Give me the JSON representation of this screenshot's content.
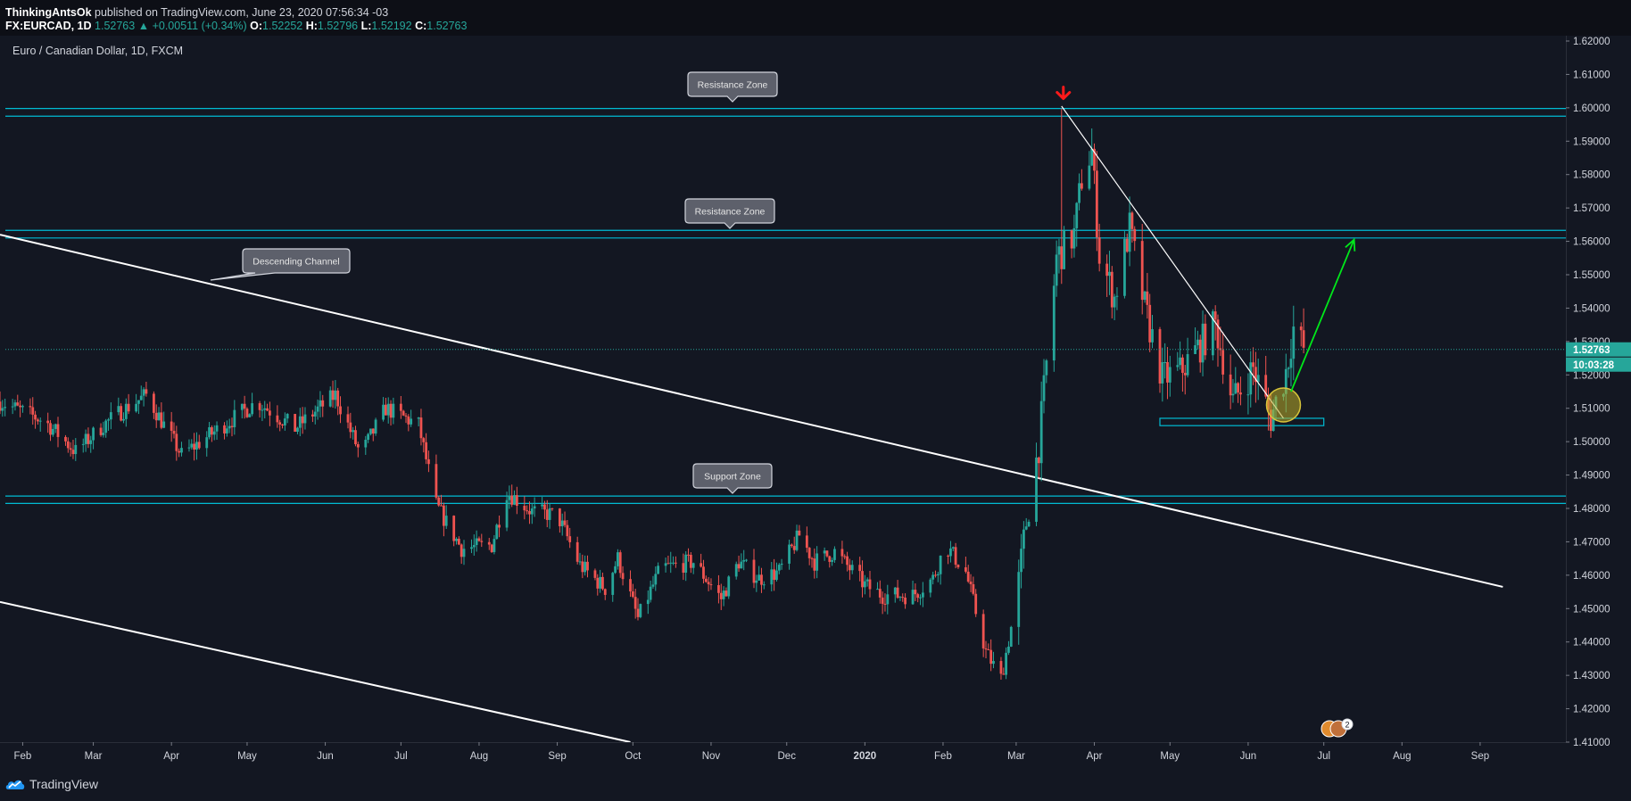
{
  "header": {
    "author": "ThinkingAntsOk",
    "published": "published on TradingView.com, June 23, 2020 07:56:34 -03",
    "symbol": "FX:EURCAD, 1D",
    "last": "1.52763",
    "change": "+0.00511 (+0.34%)",
    "o_label": "O:",
    "o": "1.52252",
    "h_label": "H:",
    "h": "1.52796",
    "l_label": "L:",
    "l": "1.52192",
    "c_label": "C:",
    "c": "1.52763"
  },
  "footer": {
    "brand": "TradingView"
  },
  "chart_data": {
    "type": "candlestick",
    "title": "Euro / Canadian Dollar, 1D, FXCM",
    "ylim": [
      1.41,
      1.62
    ],
    "y_ticks": [
      "1.41000",
      "1.42000",
      "1.43000",
      "1.44000",
      "1.45000",
      "1.46000",
      "1.47000",
      "1.48000",
      "1.49000",
      "1.50000",
      "1.51000",
      "1.52000",
      "1.53000",
      "1.54000",
      "1.55000",
      "1.56000",
      "1.57000",
      "1.58000",
      "1.59000",
      "1.60000",
      "1.61000",
      "1.62000"
    ],
    "x_ticks": [
      "Feb",
      "Mar",
      "Apr",
      "May",
      "Jun",
      "Jul",
      "Aug",
      "Sep",
      "Oct",
      "Nov",
      "Dec",
      "2020",
      "Feb",
      "Mar",
      "Apr",
      "May",
      "Jun",
      "Jul",
      "Aug",
      "Sep"
    ],
    "x_range": [
      "2019-01-23",
      "2020-10-05"
    ],
    "last_price": "1.52763",
    "countdown": "10:03:28",
    "colors": {
      "up": "#26a69a",
      "down": "#ef5350",
      "zone": "#00bcd4",
      "trend": "#ffffff",
      "target": "#00e81a",
      "peak_marker": "#ff1a1a"
    },
    "closes": [
      {
        "d": "2019-01-23",
        "v": 1.512
      },
      {
        "d": "2019-02-10",
        "v": 1.506
      },
      {
        "d": "2019-02-22",
        "v": 1.497
      },
      {
        "d": "2019-03-05",
        "v": 1.505
      },
      {
        "d": "2019-03-12",
        "v": 1.509
      },
      {
        "d": "2019-03-22",
        "v": 1.514
      },
      {
        "d": "2019-04-05",
        "v": 1.496
      },
      {
        "d": "2019-04-20",
        "v": 1.504
      },
      {
        "d": "2019-05-05",
        "v": 1.512
      },
      {
        "d": "2019-05-20",
        "v": 1.504
      },
      {
        "d": "2019-06-05",
        "v": 1.514
      },
      {
        "d": "2019-06-15",
        "v": 1.496
      },
      {
        "d": "2019-06-25",
        "v": 1.51
      },
      {
        "d": "2019-07-08",
        "v": 1.505
      },
      {
        "d": "2019-07-15",
        "v": 1.481
      },
      {
        "d": "2019-07-25",
        "v": 1.468
      },
      {
        "d": "2019-08-06",
        "v": 1.469
      },
      {
        "d": "2019-08-12",
        "v": 1.485
      },
      {
        "d": "2019-08-22",
        "v": 1.479
      },
      {
        "d": "2019-09-01",
        "v": 1.478
      },
      {
        "d": "2019-09-10",
        "v": 1.463
      },
      {
        "d": "2019-09-20",
        "v": 1.456
      },
      {
        "d": "2019-09-25",
        "v": 1.465
      },
      {
        "d": "2019-10-03",
        "v": 1.447
      },
      {
        "d": "2019-10-12",
        "v": 1.462
      },
      {
        "d": "2019-10-25",
        "v": 1.464
      },
      {
        "d": "2019-11-05",
        "v": 1.453
      },
      {
        "d": "2019-11-12",
        "v": 1.464
      },
      {
        "d": "2019-11-20",
        "v": 1.459
      },
      {
        "d": "2019-11-28",
        "v": 1.461
      },
      {
        "d": "2019-12-06",
        "v": 1.472
      },
      {
        "d": "2019-12-12",
        "v": 1.464
      },
      {
        "d": "2019-12-20",
        "v": 1.467
      },
      {
        "d": "2020-01-01",
        "v": 1.457
      },
      {
        "d": "2020-01-08",
        "v": 1.454
      },
      {
        "d": "2020-01-20",
        "v": 1.454
      },
      {
        "d": "2020-01-28",
        "v": 1.459
      },
      {
        "d": "2020-02-02",
        "v": 1.469
      },
      {
        "d": "2020-02-10",
        "v": 1.461
      },
      {
        "d": "2020-02-18",
        "v": 1.437
      },
      {
        "d": "2020-02-24",
        "v": 1.429
      },
      {
        "d": "2020-03-01",
        "v": 1.452
      },
      {
        "d": "2020-03-05",
        "v": 1.476
      },
      {
        "d": "2020-03-10",
        "v": 1.499
      },
      {
        "d": "2020-03-12",
        "v": 1.515
      },
      {
        "d": "2020-03-17",
        "v": 1.555
      },
      {
        "d": "2020-03-24",
        "v": 1.562
      },
      {
        "d": "2020-03-27",
        "v": 1.579
      },
      {
        "d": "2020-03-31",
        "v": 1.587
      },
      {
        "d": "2020-04-03",
        "v": 1.556
      },
      {
        "d": "2020-04-09",
        "v": 1.543
      },
      {
        "d": "2020-04-15",
        "v": 1.564
      },
      {
        "d": "2020-04-21",
        "v": 1.54
      },
      {
        "d": "2020-04-28",
        "v": 1.519
      },
      {
        "d": "2020-05-05",
        "v": 1.521
      },
      {
        "d": "2020-05-12",
        "v": 1.528
      },
      {
        "d": "2020-05-19",
        "v": 1.535
      },
      {
        "d": "2020-05-26",
        "v": 1.512
      },
      {
        "d": "2020-06-03",
        "v": 1.522
      },
      {
        "d": "2020-06-10",
        "v": 1.507
      },
      {
        "d": "2020-06-16",
        "v": 1.521
      },
      {
        "d": "2020-06-19",
        "v": 1.534
      },
      {
        "d": "2020-06-23",
        "v": 1.528
      }
    ],
    "peak": {
      "d": "2020-03-19",
      "v": 1.5998
    },
    "zones": [
      {
        "label": "Resistance Zone",
        "top": 1.5998,
        "bottom": 1.5975
      },
      {
        "label": "Resistance Zone",
        "top": 1.5633,
        "bottom": 1.561
      },
      {
        "label": "Support Zone",
        "top": 1.4837,
        "bottom": 1.4815
      }
    ],
    "small_zone": {
      "from": "2020-04-27",
      "to": "2020-07-01",
      "top": 1.507,
      "bottom": 1.5048
    },
    "channel_upper": [
      {
        "d": "2019-01-23",
        "v": 1.562
      },
      {
        "d": "2020-09-10",
        "v": 1.4565
      }
    ],
    "channel_lower": [
      {
        "d": "2019-01-23",
        "v": 1.452
      },
      {
        "d": "2019-09-30",
        "v": 1.41
      }
    ],
    "channel_label": "Descending Channel",
    "channel_label_anchor": {
      "d": "2019-04-09",
      "v": 1.5485
    },
    "trendline": [
      {
        "d": "2020-03-19",
        "v": 1.6005
      },
      {
        "d": "2020-06-15",
        "v": 1.507
      }
    ],
    "target_arrow": [
      {
        "d": "2020-06-18",
        "v": 1.515
      },
      {
        "d": "2020-07-13",
        "v": 1.5605
      }
    ],
    "highlight_circle": {
      "d": "2020-06-15",
      "v": 1.511
    }
  }
}
